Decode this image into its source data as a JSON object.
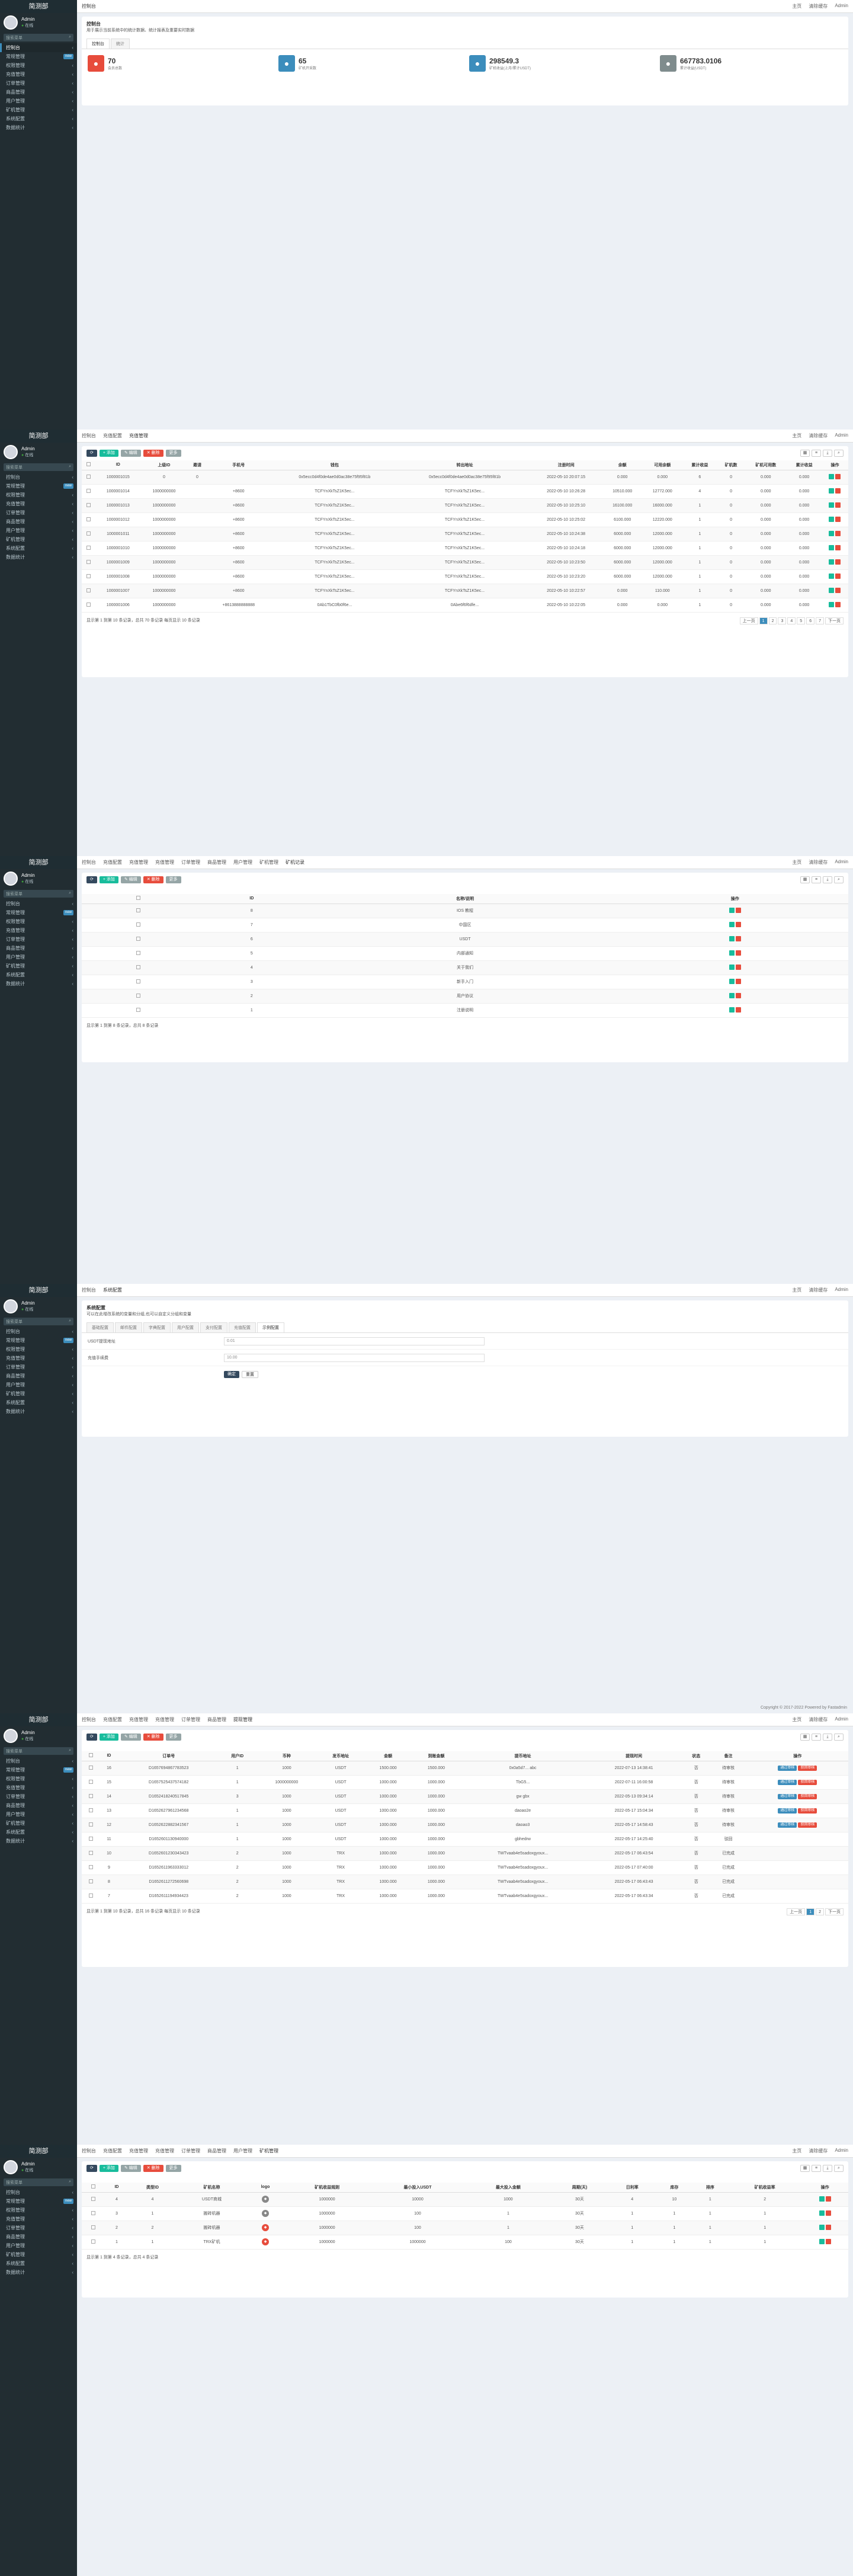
{
  "brand": "简测部",
  "user": {
    "name": "Admin",
    "status": "在线"
  },
  "search_placeholder": "搜索菜单",
  "menu": [
    "控制台",
    "常规管理",
    "权限管理",
    "充值管理",
    "订单管理",
    "商品管理",
    "用户管理",
    "矿机管理",
    "系统配置",
    "数据统计"
  ],
  "badge": "new",
  "top_right": [
    "主页",
    "清除缓存",
    "Admin"
  ],
  "p1": {
    "tabs": [
      "控制台"
    ],
    "title": "控制台",
    "desc": "用于展示当前系统中的统计数据、统计报表及重要实时数据",
    "subtabs": [
      "控制台",
      "统计"
    ],
    "cards": [
      {
        "value": "70",
        "label": "会员总数",
        "color": "#e74c3c",
        "icon": "users-icon"
      },
      {
        "value": "65",
        "label": "矿机开采数",
        "color": "#3c8dbc",
        "icon": "wrench-icon"
      },
      {
        "value": "298549.3",
        "label": "矿机收益(上月/累计USDT)",
        "color": "#3c8dbc",
        "icon": "leaf-icon"
      },
      {
        "value": "667783.0106",
        "label": "累计收益(USDT)",
        "color": "#7f8c8d",
        "icon": "user-icon"
      }
    ]
  },
  "p2": {
    "tabs": [
      "控制台",
      "充值配置",
      "充值管理"
    ],
    "buttons": [
      "刷新",
      "添加",
      "编辑",
      "删除"
    ],
    "cols": [
      "ID",
      "上级ID",
      "邀请",
      "手机号",
      "钱包",
      "转出地址",
      "注册时间",
      "余额",
      "可用余额",
      "累计收益",
      "矿机数",
      "矿机可用数",
      "累计收益",
      "操作"
    ],
    "rows": [
      [
        "1000001015",
        "0",
        "0",
        "",
        "0x5ecc0d4f0de4ae0d0ac38e75f95f81b",
        "0x5ecc0d4f0de4ae0d0ac38e75f95f81b",
        "2022-05-10 20:07:15",
        "0.000",
        "0.000",
        "6",
        "0",
        "0.000",
        "0.000"
      ],
      [
        "1000001014",
        "1000000000",
        "",
        "+8600",
        "TCFYnXkTsZ1K5ec...",
        "TCFYnXkTsZ1K5ec...",
        "2022-05-10 10:26:28",
        "10510.000",
        "12772.000",
        "4",
        "0",
        "0.000",
        "0.000"
      ],
      [
        "1000001013",
        "1000000000",
        "",
        "+8600",
        "TCFYnXkTsZ1K5ec...",
        "TCFYnXkTsZ1K5ec...",
        "2022-05-10 10:25:10",
        "16100.000",
        "16000.000",
        "1",
        "0",
        "0.000",
        "0.000"
      ],
      [
        "1000001012",
        "1000000000",
        "",
        "+8600",
        "TCFYnXkTsZ1K5ec...",
        "TCFYnXkTsZ1K5ec...",
        "2022-05-10 10:25:02",
        "6100.000",
        "12220.000",
        "1",
        "0",
        "0.000",
        "0.000"
      ],
      [
        "1000001011",
        "1000000000",
        "",
        "+8600",
        "TCFYnXkTsZ1K5ec...",
        "TCFYnXkTsZ1K5ec...",
        "2022-05-10 10:24:38",
        "6000.000",
        "12000.000",
        "1",
        "0",
        "0.000",
        "0.000"
      ],
      [
        "1000001010",
        "1000000000",
        "",
        "+8600",
        "TCFYnXkTsZ1K5ec...",
        "TCFYnXkTsZ1K5ec...",
        "2022-05-10 10:24:18",
        "6000.000",
        "12000.000",
        "1",
        "0",
        "0.000",
        "0.000"
      ],
      [
        "1000001009",
        "1000000000",
        "",
        "+8600",
        "TCFYnXkTsZ1K5ec...",
        "TCFYnXkTsZ1K5ec...",
        "2022-05-10 10:23:50",
        "6000.000",
        "12000.000",
        "1",
        "0",
        "0.000",
        "0.000"
      ],
      [
        "1000001008",
        "1000000000",
        "",
        "+8600",
        "TCFYnXkTsZ1K5ec...",
        "TCFYnXkTsZ1K5ec...",
        "2022-05-10 10:23:20",
        "6000.000",
        "12000.000",
        "1",
        "0",
        "0.000",
        "0.000"
      ],
      [
        "1000001007",
        "1000000000",
        "",
        "+8600",
        "TCFYnXkTsZ1K5ec...",
        "TCFYnXkTsZ1K5ec...",
        "2022-05-10 10:22:57",
        "0.000",
        "110.000",
        "1",
        "0",
        "0.000",
        "0.000"
      ],
      [
        "1000001006",
        "1000000000",
        "",
        "+8613888888888",
        "0Ab1TbC0fb0f6e...",
        "0Abe6f6f6dfe...",
        "2022-05-10 10:22:05",
        "0.000",
        "0.000",
        "1",
        "0",
        "0.000",
        "0.000"
      ]
    ],
    "footer": "显示第 1 到第 10 条记录，总共 70 条记录 每页显示 10 条记录",
    "pages": [
      "上一页",
      "1",
      "2",
      "3",
      "4",
      "5",
      "6",
      "7",
      "下一页"
    ]
  },
  "p3": {
    "tabs": [
      "控制台",
      "充值配置",
      "充值管理",
      "充值管理",
      "订单管理",
      "商品管理",
      "用户管理",
      "矿机管理",
      "矿机记录"
    ],
    "cols": [
      "ID",
      "名称/说明",
      "操作"
    ],
    "rows": [
      [
        "8",
        "IOS 教程"
      ],
      [
        "7",
        "中国区"
      ],
      [
        "6",
        "USDT"
      ],
      [
        "5",
        "内部通知"
      ],
      [
        "4",
        "关于我们"
      ],
      [
        "3",
        "新手入门"
      ],
      [
        "2",
        "用户协议"
      ],
      [
        "1",
        "注册说明"
      ]
    ],
    "footer": "显示第 1 到第 8 条记录，总共 8 条记录"
  },
  "p4": {
    "title": "系统配置",
    "desc": "可以在此增改系统的变量和分组,也可以自定义分组和变量",
    "subtabs": [
      "基础配置",
      "邮件配置",
      "字典配置",
      "用户配置",
      "支付配置",
      "充值配置",
      "示例配置"
    ],
    "fields": [
      {
        "label": "USDT提现地址",
        "value": "0.01"
      },
      {
        "label": "充值手续费",
        "value": "10.00"
      }
    ],
    "ok": "确定",
    "reset": "重置",
    "copyright": "Copyright © 2017-2022 Powered by Fastadmin"
  },
  "p5": {
    "tabs": [
      "控制台",
      "充值配置",
      "充值管理",
      "充值管理",
      "订单管理",
      "商品管理",
      "提现管理"
    ],
    "cols": [
      "ID",
      "订单号",
      "用户ID",
      "币种",
      "发币地址",
      "金额",
      "到账金额",
      "提币地址",
      "提现时间",
      "状态",
      "备注",
      "操作"
    ],
    "rows": [
      [
        "16",
        "D1657694867783523",
        "1",
        "1000",
        "USDT",
        "1500.000",
        "1500.000",
        "0x0a5d7... abc",
        "2022-07-13 14:38:41",
        "否",
        "待审核"
      ],
      [
        "15",
        "D1657525437574182",
        "1",
        "1000000000",
        "USDT",
        "1000.000",
        "1000.000",
        "TbG5...",
        "2022-07-11 16:00:58",
        "否",
        "待审核"
      ],
      [
        "14",
        "D1652418240517845",
        "3",
        "1000",
        "USDT",
        "1000.000",
        "1000.000",
        "gw gbx",
        "2022-05-13 09:34:14",
        "否",
        "待审核"
      ],
      [
        "13",
        "D1652627961234568",
        "1",
        "1000",
        "USDT",
        "1000.000",
        "1000.000",
        "daoao2e",
        "2022-05-17 15:04:34",
        "否",
        "待审核"
      ],
      [
        "12",
        "D1652622882341567",
        "1",
        "1000",
        "USDT",
        "1000.000",
        "1000.000",
        "daoao3",
        "2022-05-17 14:58:43",
        "否",
        "待审核"
      ],
      [
        "11",
        "D1652601130940000",
        "1",
        "1000",
        "USDT",
        "1000.000",
        "1000.000",
        "gbhedrw",
        "2022-05-17 14:25:40",
        "否",
        "驳回"
      ],
      [
        "10",
        "D1652601230343423",
        "2",
        "1000",
        "TRX",
        "1000.000",
        "1000.000",
        "TWTvaab4e5sadoxgyoux...",
        "2022-05-17 06:43:54",
        "否",
        "已完成"
      ],
      [
        "9",
        "D1652611963333012",
        "2",
        "1000",
        "TRX",
        "1000.000",
        "1000.000",
        "TWTvaab4e5sadoxgyoux...",
        "2022-05-17 07:40:00",
        "否",
        "已完成"
      ],
      [
        "8",
        "D1652611272560698",
        "2",
        "1000",
        "TRX",
        "1000.000",
        "1000.000",
        "TWTvaab4e5sadoxgyoux...",
        "2022-05-17 06:43:43",
        "否",
        "已完成"
      ],
      [
        "7",
        "D1652611194934423",
        "2",
        "1000",
        "TRX",
        "1000.000",
        "1000.000",
        "TWTvaab4e5sadoxgyoux...",
        "2022-05-17 06:43:34",
        "否",
        "已完成"
      ]
    ],
    "pass": "通过审核",
    "reject": "驳回审核",
    "footer": "显示第 1 到第 10 条记录，总共 16 条记录 每页显示 10 条记录"
  },
  "p6": {
    "tabs": [
      "控制台",
      "充值配置",
      "充值管理",
      "充值管理",
      "订单管理",
      "商品管理",
      "用户管理",
      "矿机管理"
    ],
    "cols": [
      "ID",
      "类型ID",
      "矿机名称",
      "logo",
      "矿机收益规则",
      "最小投入USDT",
      "最大投入金额",
      "周期(天)",
      "日利率",
      "库存",
      "排序",
      "矿机收益率",
      "操作"
    ],
    "rows": [
      [
        "4",
        "4",
        "USDT商城",
        "",
        "1000000",
        "10000",
        "1000",
        "30天",
        "4",
        "10",
        "1",
        "2"
      ],
      [
        "3",
        "1",
        "搬砖机器",
        "",
        "1000000",
        "100",
        "1",
        "30天",
        "1",
        "1",
        "1",
        "1"
      ],
      [
        "2",
        "2",
        "搬砖机器",
        "",
        "1000000",
        "100",
        "1",
        "30天",
        "1",
        "1",
        "1",
        "1"
      ],
      [
        "1",
        "1",
        "TRX矿机",
        "",
        "1000000",
        "1000000",
        "100",
        "30天",
        "1",
        "1",
        "1",
        "1"
      ]
    ],
    "footer": "显示第 1 到第 4 条记录，总共 4 条记录"
  }
}
